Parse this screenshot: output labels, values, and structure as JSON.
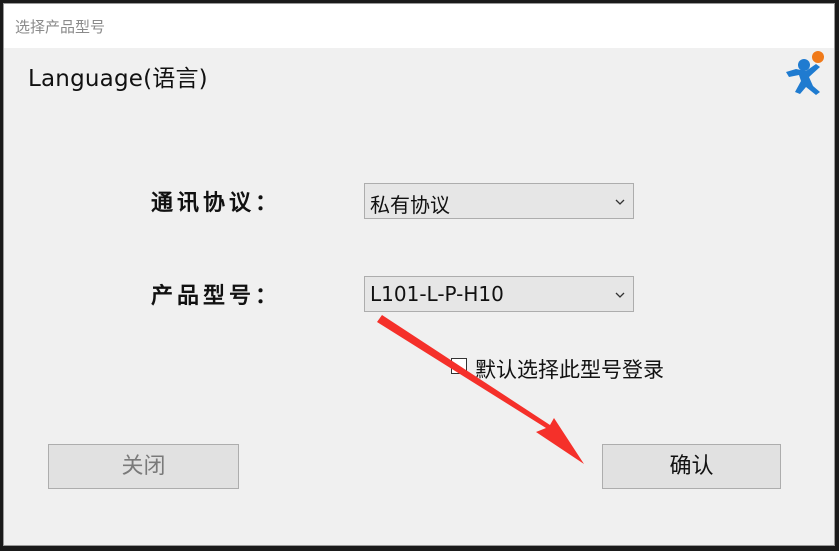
{
  "window": {
    "title": "选择产品型号"
  },
  "header": {
    "language_link": "Language(语言)",
    "logo_icon": "running-person-logo"
  },
  "form": {
    "protocol": {
      "label": "通讯协议：",
      "selected": "私有协议"
    },
    "model": {
      "label": "产品型号：",
      "selected": "L101-L-P-H10"
    },
    "remember": {
      "label": "默认选择此型号登录",
      "checked": false
    }
  },
  "buttons": {
    "close_label": "关闭",
    "confirm_label": "确认"
  },
  "colors": {
    "annotation_arrow": "#f5302a",
    "logo_orange": "#f07a1a",
    "logo_blue": "#1f7bd0"
  }
}
